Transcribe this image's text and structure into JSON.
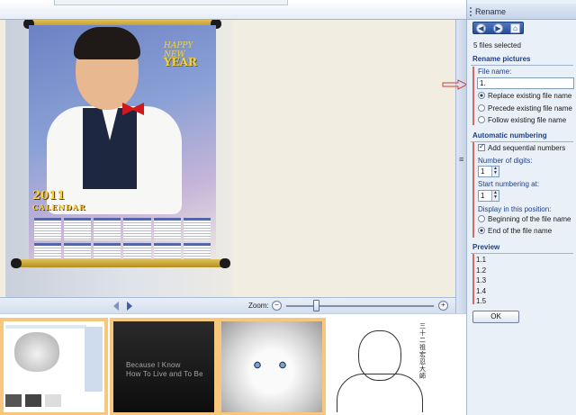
{
  "panel": {
    "title": "Rename",
    "nav": {
      "back_icon": "back-arrow-icon",
      "forward_icon": "forward-arrow-icon",
      "home_icon": "home-icon"
    },
    "files_selected": "5 files selected",
    "rename_section": {
      "heading": "Rename pictures",
      "file_name_label": "File name:",
      "file_name_value": "1.",
      "options": [
        {
          "label": "Replace existing file name",
          "selected": true
        },
        {
          "label": "Precede existing file name",
          "selected": false
        },
        {
          "label": "Follow existing file name",
          "selected": false
        }
      ]
    },
    "numbering_section": {
      "heading": "Automatic numbering",
      "add_sequential_label": "Add sequential numbers",
      "add_sequential_checked": true,
      "digits_label": "Number of digits:",
      "digits_value": "1",
      "start_label": "Start numbering at:",
      "start_value": "1",
      "position_label": "Display in this position:",
      "position_options": [
        {
          "label": "Beginning of the file name",
          "selected": false
        },
        {
          "label": "End of the file name",
          "selected": true
        }
      ]
    },
    "preview_section": {
      "heading": "Preview",
      "items": [
        "1.1",
        "1.2",
        "1.3",
        "1.4",
        "1.5"
      ]
    },
    "ok_label": "OK"
  },
  "viewer": {
    "zoom_label": "Zoom:",
    "zoom_out_icon": "zoom-out-icon",
    "zoom_in_icon": "zoom-in-icon",
    "zoom_level_fraction": 0.2,
    "prev_icon": "previous-arrow-icon",
    "next_icon": "next-arrow-icon"
  },
  "photo": {
    "calendar_year": "2011",
    "calendar_word": "CALENDAR",
    "greeting_line": "HAPPY NEW",
    "greeting_year": "YEAR"
  },
  "thumbnails": [
    {
      "selected": true
    },
    {
      "selected": true,
      "text_lines": [
        "Because I Know",
        "How To Live and To Be"
      ]
    },
    {
      "selected": true
    },
    {
      "selected": false,
      "caption": "三十二祖宏忍大師"
    }
  ],
  "colors": {
    "accent": "#1f3f86",
    "selection": "#f6c77d",
    "annotation": "#d56a6a"
  }
}
